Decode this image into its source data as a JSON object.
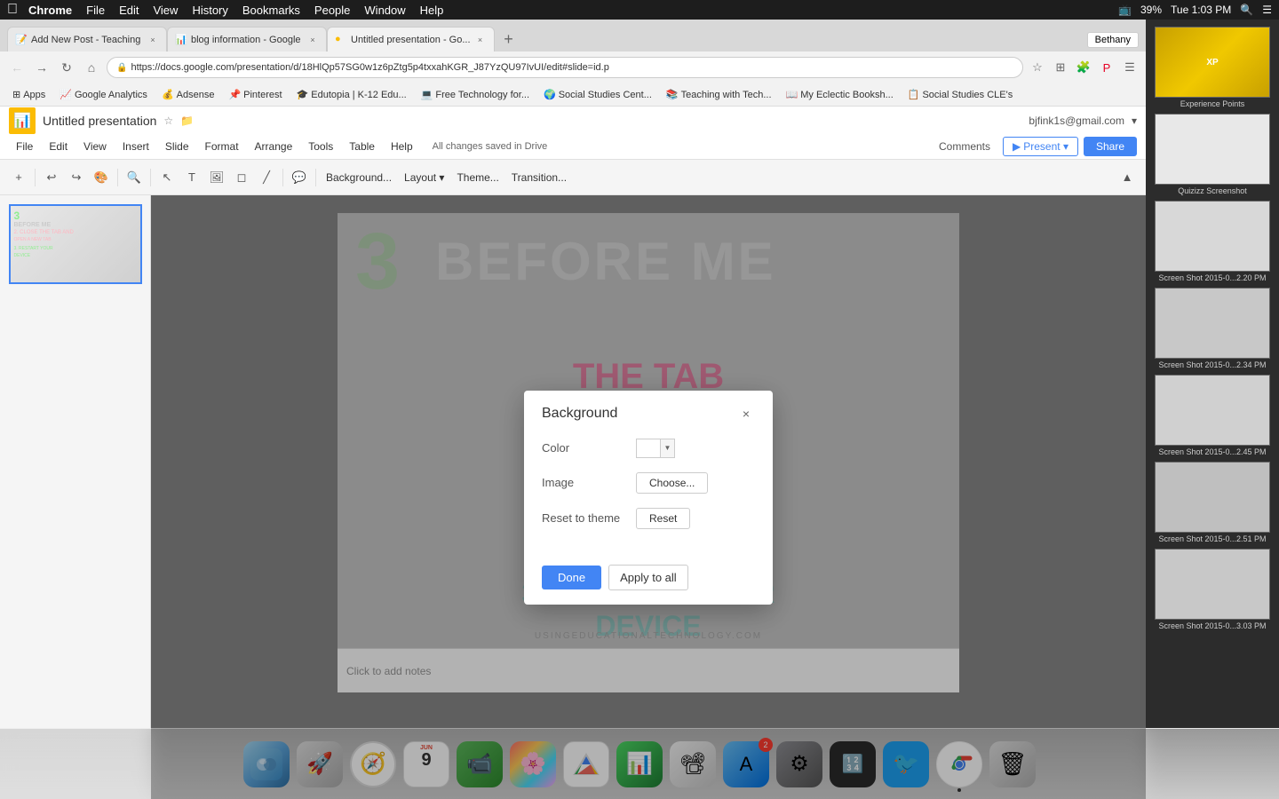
{
  "menubar": {
    "apple": "⌘",
    "items": [
      "Chrome",
      "File",
      "Edit",
      "View",
      "History",
      "Bookmarks",
      "People",
      "Window",
      "Help"
    ],
    "right": {
      "time": "Tue 1:03 PM",
      "battery": "39%",
      "user": "Bethany"
    }
  },
  "tabs": [
    {
      "title": "Add New Post - Teaching",
      "active": false,
      "favicon": "📝"
    },
    {
      "title": "blog information - Google",
      "active": false,
      "favicon": "📊"
    },
    {
      "title": "Untitled presentation - Go...",
      "active": true,
      "favicon": "🟡"
    }
  ],
  "addressbar": {
    "url": "https://docs.google.com/presentation/d/18HlQp57SG0w1z6pZtg5p4txxahKGR_J87YzQU97IvUI/edit#slide=id.p"
  },
  "bookmarks": [
    {
      "label": "Apps",
      "icon": "⚙"
    },
    {
      "label": "Google Analytics",
      "icon": "📈"
    },
    {
      "label": "Adsense",
      "icon": "💰"
    },
    {
      "label": "Pinterest",
      "icon": "📌"
    },
    {
      "label": "Edutopia | K-12 Edu...",
      "icon": "🎓"
    },
    {
      "label": "Free Technology for...",
      "icon": "💻"
    },
    {
      "label": "Social Studies Cent...",
      "icon": "🌍"
    },
    {
      "label": "Teaching with Tech...",
      "icon": "📚"
    },
    {
      "label": "My Eclectic Booksh...",
      "icon": "📖"
    },
    {
      "label": "Social Studies CLE's",
      "icon": "📋"
    }
  ],
  "slides": {
    "title": "Untitled presentation",
    "user_email": "bjfink1s@gmail.com",
    "save_status": "All changes saved in Drive",
    "menu_items": [
      "File",
      "Edit",
      "View",
      "Insert",
      "Slide",
      "Format",
      "Arrange",
      "Tools",
      "Table",
      "Help"
    ],
    "toolbar_items": [
      "+",
      "↩",
      "↪",
      "✂",
      "🔍",
      "↖",
      "T",
      "🖼",
      "🔷",
      "✏",
      "📋",
      "Background...",
      "Layout▾",
      "Theme...",
      "Transition..."
    ],
    "slide_content": {
      "number": "3",
      "line1": "BEFORE ME",
      "line2": "2. CLOSE THE TAB",
      "line3": "RESTART YOUR DEVICE"
    }
  },
  "dialog": {
    "title": "Background",
    "close_label": "×",
    "color_label": "Color",
    "image_label": "Image",
    "reset_label": "Reset to theme",
    "choose_btn": "Choose...",
    "reset_btn": "Reset",
    "done_btn": "Done",
    "apply_all_btn": "Apply to all"
  },
  "notes": {
    "placeholder": "Click to add notes"
  },
  "right_panel": {
    "thumbnails": [
      {
        "label": "Experience Points"
      },
      {
        "label": "Quizizz Screenshot"
      },
      {
        "label": "Screen Shot 2015-0...2.20 PM"
      },
      {
        "label": "Screen Shot 2015-0...2.34 PM"
      },
      {
        "label": "Screen Shot 2015-0...2.45 PM"
      },
      {
        "label": "Screen Shot 2015-0...2.51 PM"
      },
      {
        "label": "Screen Shot 2015-0...3.03 PM"
      }
    ]
  },
  "dock": {
    "items": [
      {
        "name": "Finder",
        "type": "finder",
        "icon": "🖥"
      },
      {
        "name": "Launchpad",
        "type": "rocket",
        "icon": "🚀"
      },
      {
        "name": "Safari",
        "type": "safari",
        "icon": "🧭"
      },
      {
        "name": "Calendar",
        "type": "calendar",
        "month": "JUN",
        "day": "9"
      },
      {
        "name": "FaceTime",
        "type": "facetime",
        "icon": "📹"
      },
      {
        "name": "Photos",
        "type": "photos",
        "icon": "🌸"
      },
      {
        "name": "Google Drive",
        "type": "drive",
        "icon": "△"
      },
      {
        "name": "Numbers",
        "type": "numbers",
        "icon": "📊"
      },
      {
        "name": "Keynote",
        "type": "keynote",
        "icon": "📽"
      },
      {
        "name": "App Store",
        "type": "appstore",
        "icon": "⊕",
        "badge": "2"
      },
      {
        "name": "System Preferences",
        "type": "settings",
        "icon": "⚙"
      },
      {
        "name": "Calculator",
        "type": "calculator",
        "icon": "🔢"
      },
      {
        "name": "Twitter",
        "type": "twitter",
        "icon": "🐦"
      },
      {
        "name": "Chrome",
        "type": "chrome",
        "icon": "◎",
        "dot": true
      },
      {
        "name": "Trash",
        "type": "trash",
        "icon": "🗑"
      }
    ]
  }
}
